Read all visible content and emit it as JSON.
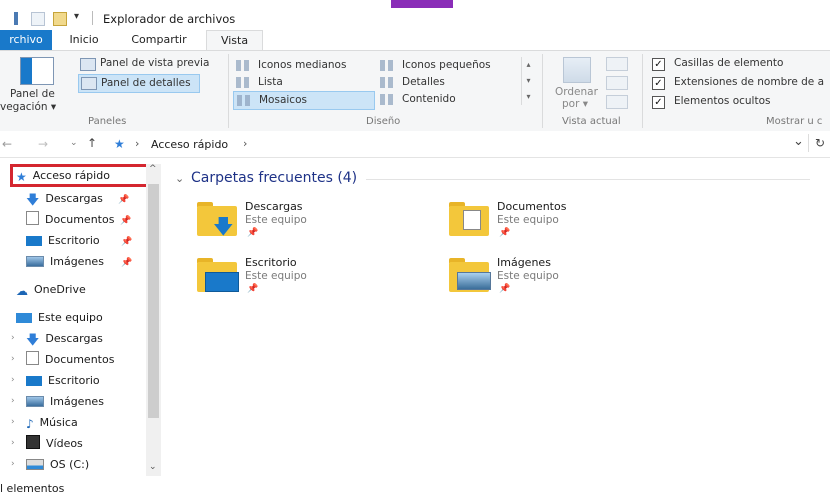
{
  "window": {
    "title": "Explorador de archivos"
  },
  "tabs": [
    {
      "label": "rchivo"
    },
    {
      "label": "Inicio"
    },
    {
      "label": "Compartir"
    },
    {
      "label": "Vista"
    }
  ],
  "ribbon": {
    "panes": {
      "nav_pane_line1": "Panel de",
      "nav_pane_line2": "vegación ▾",
      "preview_pane": "Panel de vista previa",
      "details_pane": "Panel de detalles",
      "group_label": "Paneles"
    },
    "layout": {
      "items": [
        {
          "label": "Iconos medianos"
        },
        {
          "label": "Iconos pequeños"
        },
        {
          "label": "Lista"
        },
        {
          "label": "Detalles"
        },
        {
          "label": "Mosaicos"
        },
        {
          "label": "Contenido"
        }
      ],
      "selected": "Mosaicos",
      "group_label": "Diseño"
    },
    "current_view": {
      "sort_line1": "Ordenar",
      "sort_line2": "por ▾",
      "group_label": "Vista actual"
    },
    "show_hide": {
      "items": [
        {
          "label": "Casillas de elemento",
          "checked": true
        },
        {
          "label": "Extensiones de nombre de a",
          "checked": true
        },
        {
          "label": "Elementos ocultos",
          "checked": true
        }
      ],
      "group_label": "Mostrar u c"
    }
  },
  "address": {
    "path_root": "Acceso rápido",
    "path_sep": "›",
    "dropdown": "⌄",
    "refresh": "↻"
  },
  "nav": {
    "quick_access": "Acceso rápido",
    "qa_items": [
      {
        "label": "Descargas"
      },
      {
        "label": "Documentos"
      },
      {
        "label": "Escritorio"
      },
      {
        "label": "Imágenes"
      }
    ],
    "onedrive": "OneDrive",
    "this_pc": "Este equipo",
    "pc_items": [
      {
        "label": "Descargas"
      },
      {
        "label": "Documentos"
      },
      {
        "label": "Escritorio"
      },
      {
        "label": "Imágenes"
      },
      {
        "label": "Música"
      },
      {
        "label": "Vídeos"
      },
      {
        "label": "OS (C:)"
      }
    ]
  },
  "content": {
    "section_title": "Carpetas frecuentes (4)",
    "folders": [
      {
        "name": "Descargas",
        "location": "Este equipo"
      },
      {
        "name": "Documentos",
        "location": "Este equipo"
      },
      {
        "name": "Escritorio",
        "location": "Este equipo"
      },
      {
        "name": "Imágenes",
        "location": "Este equipo"
      }
    ]
  },
  "status": {
    "text": "l elementos"
  },
  "colors": {
    "accent": "#1979ca",
    "highlight_border": "#d4262f",
    "title_accent": "#8a2db8",
    "section_title": "#1e3287"
  }
}
